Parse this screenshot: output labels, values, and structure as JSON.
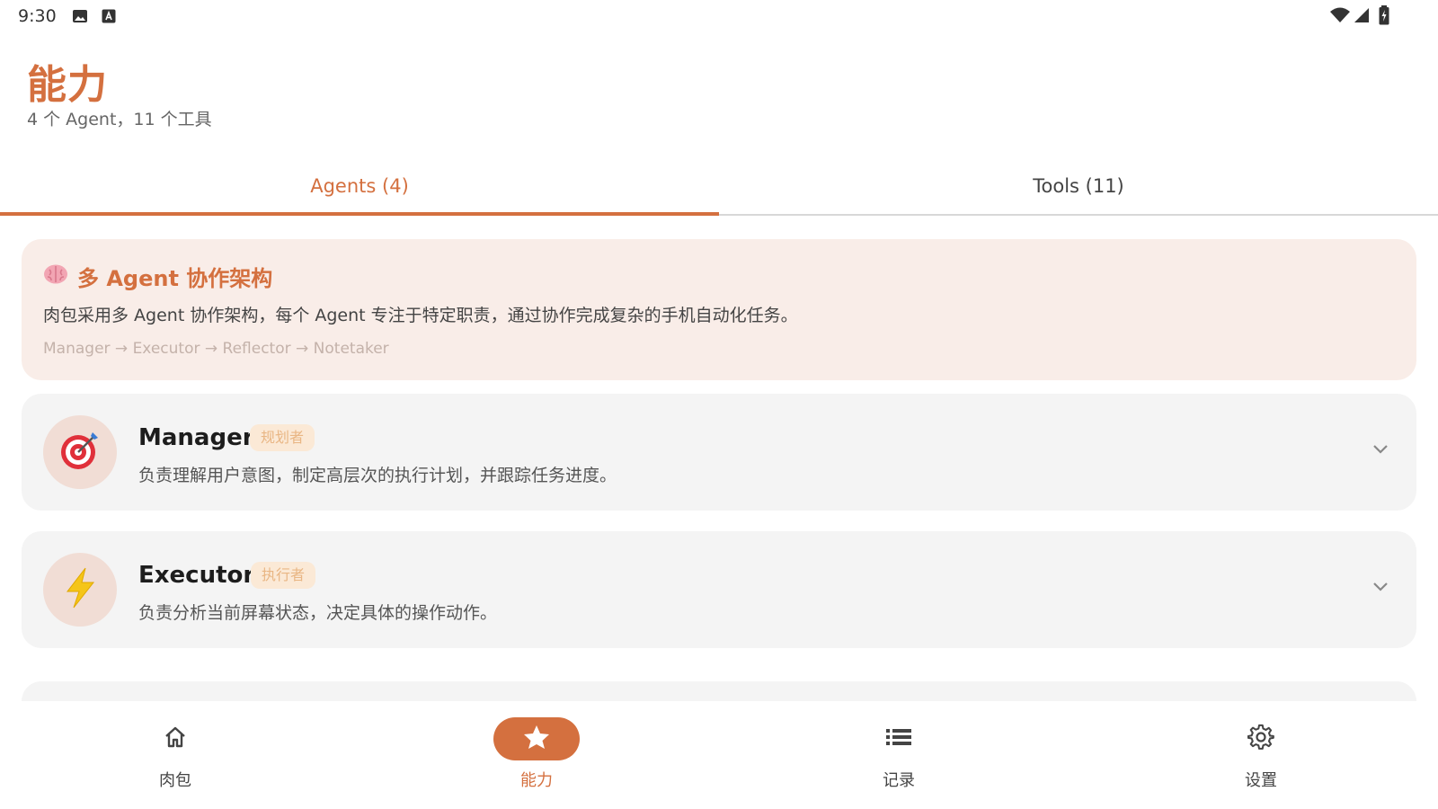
{
  "status_bar": {
    "time": "9:30",
    "icons": [
      "image-icon",
      "keyboard-a-icon",
      "wifi-icon",
      "signal-icon",
      "battery-icon"
    ]
  },
  "page": {
    "title": "能力",
    "subtitle": "4 个 Agent，11 个工具"
  },
  "tabs": [
    {
      "label": "Agents (4)",
      "active": true
    },
    {
      "label": "Tools (11)",
      "active": false
    }
  ],
  "info_card": {
    "icon": "brain-icon",
    "title": "多 Agent 协作架构",
    "description": "肉包采用多 Agent 协作架构，每个 Agent 专注于特定职责，通过协作完成复杂的手机自动化任务。",
    "flow": "Manager → Executor → Reflector → Notetaker"
  },
  "agents": [
    {
      "name": "Manager",
      "role": "规划者",
      "icon": "target-icon",
      "description": "负责理解用户意图，制定高层次的执行计划，并跟踪任务进度。"
    },
    {
      "name": "Executor",
      "role": "执行者",
      "icon": "lightning-icon",
      "description": "负责分析当前屏幕状态，决定具体的操作动作。"
    }
  ],
  "bottom_nav": [
    {
      "label": "肉包",
      "icon": "home-icon",
      "active": false
    },
    {
      "label": "能力",
      "icon": "star-icon",
      "active": true
    },
    {
      "label": "记录",
      "icon": "list-icon",
      "active": false
    },
    {
      "label": "设置",
      "icon": "gear-icon",
      "active": false
    }
  ],
  "colors": {
    "accent": "#d4703f",
    "info_card_bg": "#f9ede8",
    "card_bg": "#f4f4f4",
    "role_badge_bg": "#fbe9d6",
    "role_badge_text": "#e9b684"
  }
}
